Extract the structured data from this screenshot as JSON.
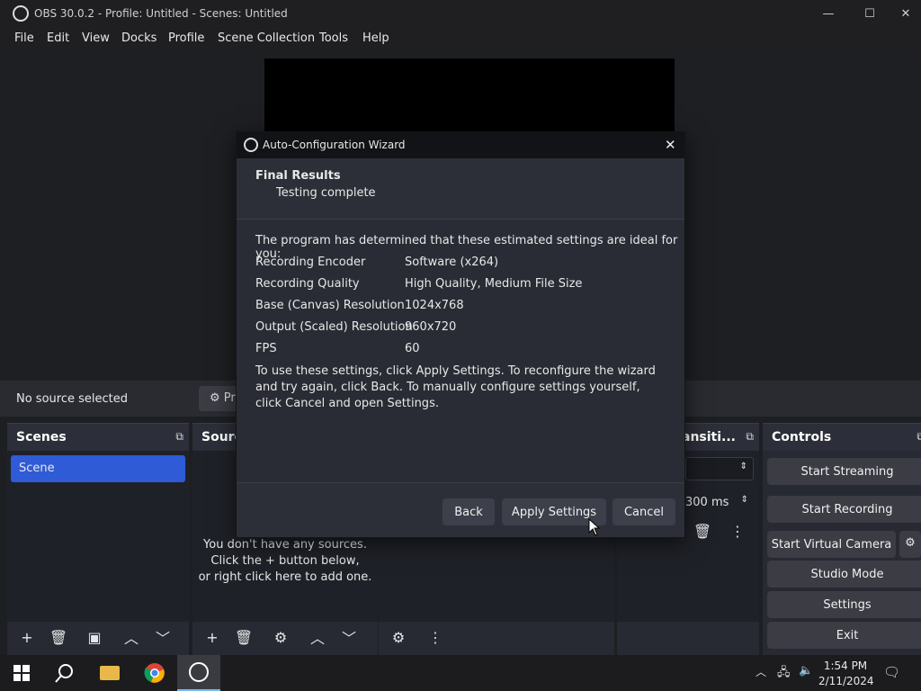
{
  "app": {
    "title": "OBS 30.0.2 - Profile: Untitled - Scenes: Untitled"
  },
  "menu": [
    "File",
    "Edit",
    "View",
    "Docks",
    "Profile",
    "Scene Collection",
    "Tools",
    "Help"
  ],
  "source_bar": {
    "no_source": "No source selected",
    "properties_label": "Pr"
  },
  "docks": {
    "scenes": {
      "title": "Scenes",
      "items": [
        "Scene"
      ]
    },
    "sources": {
      "title": "Sourc",
      "empty_text": [
        "You don't have any sources.",
        "Click the + button below,",
        "or right click here to add one."
      ]
    },
    "transitions": {
      "title": "ansiti...",
      "duration": "300 ms"
    },
    "controls": {
      "title": "Controls",
      "buttons": [
        "Start Streaming",
        "Start Recording",
        "Start Virtual Camera",
        "Studio Mode",
        "Settings",
        "Exit"
      ]
    }
  },
  "wizard": {
    "title": "Auto-Configuration Wizard",
    "heading": "Final Results",
    "subheading": "Testing complete",
    "intro": "The program has determined that these estimated settings are ideal for you:",
    "rows": [
      {
        "label": "Recording Encoder",
        "value": "Software (x264)"
      },
      {
        "label": "Recording Quality",
        "value": "High Quality, Medium File Size"
      },
      {
        "label": "Base (Canvas) Resolution",
        "value": "1024x768"
      },
      {
        "label": "Output (Scaled) Resolution",
        "value": "960x720"
      },
      {
        "label": "FPS",
        "value": "60"
      }
    ],
    "instructions": "To use these settings, click Apply Settings. To reconfigure the wizard and try again, click Back. To manually configure settings yourself, click Cancel and open Settings.",
    "buttons": {
      "back": "Back",
      "apply": "Apply Settings",
      "cancel": "Cancel"
    }
  },
  "taskbar": {
    "time": "1:54 PM",
    "date": "2/11/2024"
  },
  "colors": {
    "scene_selected": "#2f5bd6",
    "dialog_bg": "#2d2f38"
  }
}
